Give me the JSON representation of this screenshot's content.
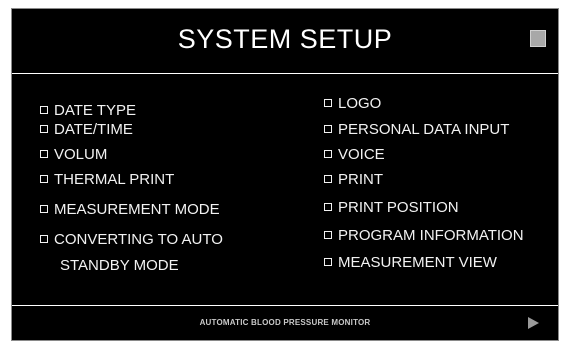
{
  "header": {
    "title": "SYSTEM SETUP",
    "close_icon": "square-icon"
  },
  "options": {
    "left": [
      {
        "label": "DATE TYPE"
      },
      {
        "label": "DATE/TIME"
      },
      {
        "label": "VOLUM"
      },
      {
        "label": "THERMAL PRINT"
      },
      {
        "label": "MEASUREMENT MODE"
      },
      {
        "label": "CONVERTING TO AUTO",
        "label_line2": "STANDBY MODE"
      }
    ],
    "right": [
      {
        "label": "LOGO"
      },
      {
        "label": "PERSONAL DATA INPUT"
      },
      {
        "label": "VOICE"
      },
      {
        "label": "PRINT"
      },
      {
        "label": "PRINT POSITION"
      },
      {
        "label": "PROGRAM INFORMATION"
      },
      {
        "label": "MEASUREMENT VIEW"
      }
    ]
  },
  "footer": {
    "label": "AUTOMATIC BLOOD PRESSURE MONITOR",
    "next_icon": "play-arrow-icon"
  },
  "colors": {
    "background": "#000000",
    "text": "#f2f2f2",
    "button_gray": "#a8a8a8",
    "arrow_gray": "#9a9a9a"
  }
}
